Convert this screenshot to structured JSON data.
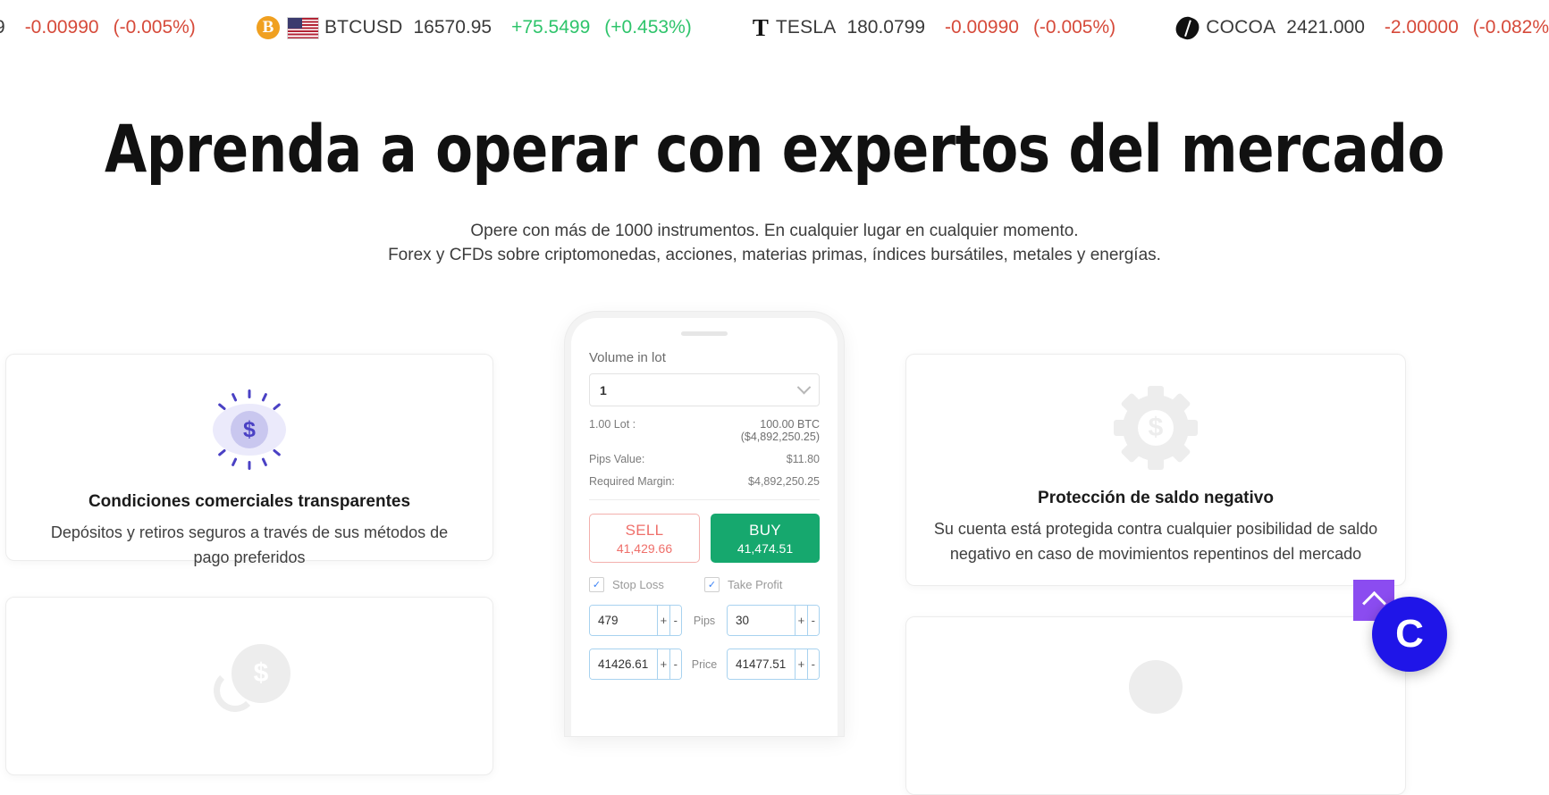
{
  "ticker": {
    "items": [
      {
        "icon": "none",
        "symbol": "",
        "price": "9",
        "change": "-0.00990",
        "percent": "(-0.005%)",
        "dir": "down",
        "partial": true
      },
      {
        "icon": "bitcoin-icon",
        "flag": "us-flag-icon",
        "symbol": "BTCUSD",
        "price": "16570.95",
        "change": "+75.5499",
        "percent": "(+0.453%)",
        "dir": "up"
      },
      {
        "icon": "tesla-icon",
        "symbol": "TESLA",
        "price": "180.0799",
        "change": "-0.00990",
        "percent": "(-0.005%)",
        "dir": "down"
      },
      {
        "icon": "cocoa-icon",
        "symbol": "COCOA",
        "price": "2421.000",
        "change": "-2.00000",
        "percent": "(-0.082%",
        "dir": "down"
      }
    ]
  },
  "hero": {
    "title": "Aprenda a operar con expertos del mercado",
    "subtitle_line1": "Opere con más de 1000 instrumentos. En cualquier lugar en cualquier momento.",
    "subtitle_line2": "Forex y CFDs sobre criptomonedas, acciones, materias primas, índices bursátiles, metales y energías."
  },
  "cards": {
    "left": {
      "icon": "dollar-burst-icon",
      "title": "Condiciones comerciales transparentes",
      "desc": "Depósitos y retiros seguros a través de sus métodos de pago preferidos"
    },
    "right": {
      "icon": "gear-dollar-icon",
      "title": "Protección de saldo negativo",
      "desc": "Su cuenta está protegida contra cualquier posibilidad de saldo negativo en caso de movimientos repentinos del mercado"
    },
    "left_bottom": {
      "icon": "money-bag-icon"
    },
    "right_bottom": {
      "icon": "circle-icon"
    }
  },
  "phone": {
    "volume_label": "Volume in lot",
    "volume_value": "1",
    "dropdown_icon": "chevron-down-icon",
    "lot_label": "1.00 Lot :",
    "lot_value": "100.00 BTC",
    "lot_value_sub": "($4,892,250.25)",
    "pips_value_label": "Pips Value:",
    "pips_value": "$11.80",
    "required_margin_label": "Required Margin:",
    "required_margin": "$4,892,250.25",
    "sell_label": "SELL",
    "sell_price": "41,429.66",
    "buy_label": "BUY",
    "buy_price": "41,474.51",
    "stop_loss_label": "Stop Loss",
    "take_profit_label": "Take Profit",
    "check_glyph": "✓",
    "stop_loss_pips": "479",
    "pips_mid_label": "Pips",
    "take_profit_pips": "30",
    "stop_loss_price": "41426.61",
    "price_mid_label": "Price",
    "take_profit_price": "41477.51",
    "plus_label": "+",
    "minus_label": "-"
  },
  "floating": {
    "scroll_top_icon": "chevron-up-icon",
    "chat_label": "C"
  },
  "colors": {
    "up": "#2ec46b",
    "down": "#d64a3a",
    "buy": "#16a86e",
    "sell": "#ef6f6a",
    "accent_purple": "#4a41c4",
    "chat_blue": "#1f15e8",
    "scroll_purple": "#8b4cf0"
  }
}
